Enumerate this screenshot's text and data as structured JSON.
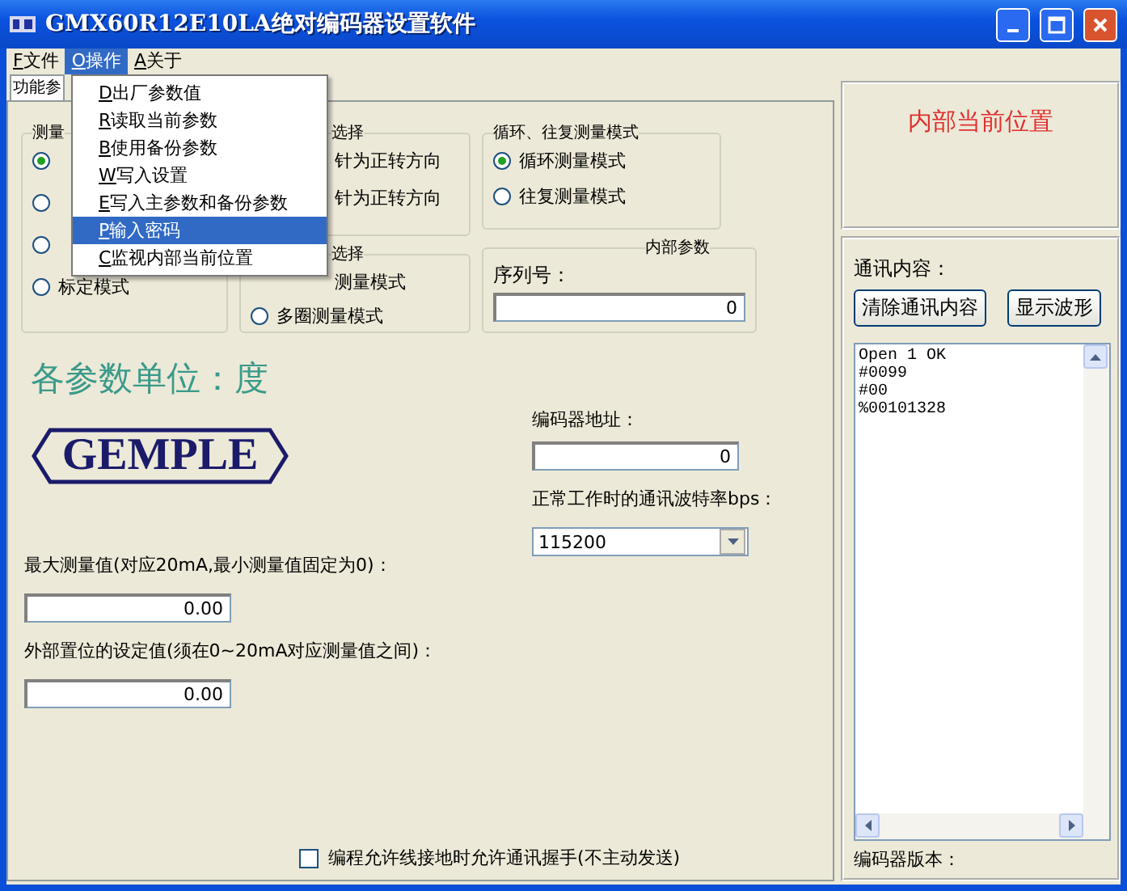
{
  "window": {
    "title": "GMX60R12E10LA绝对编码器设置软件"
  },
  "menu_bar": [
    {
      "mnemonic": "F",
      "label": "文件",
      "selected": false
    },
    {
      "mnemonic": "O",
      "label": "操作",
      "selected": true
    },
    {
      "mnemonic": "A",
      "label": "关于",
      "selected": false
    }
  ],
  "dropdown_menu": [
    {
      "mnemonic": "D",
      "label": "出厂参数值",
      "selected": false
    },
    {
      "mnemonic": "R",
      "label": "读取当前参数",
      "selected": false
    },
    {
      "mnemonic": "B",
      "label": "使用备份参数",
      "selected": false
    },
    {
      "mnemonic": "W",
      "label": "写入设置",
      "selected": false
    },
    {
      "mnemonic": "E",
      "label": "写入主参数和备份参数",
      "selected": false
    },
    {
      "mnemonic": "P",
      "label": "输入密码",
      "selected": true
    },
    {
      "mnemonic": "C",
      "label": "监视内部当前位置",
      "selected": false
    }
  ],
  "tab": {
    "label": "功能参"
  },
  "measure_group": {
    "title": "测量",
    "options": [
      {
        "selected": true
      },
      {
        "selected": false
      },
      {
        "selected": false
      },
      {
        "label": "标定模式",
        "selected": false
      }
    ]
  },
  "direction_group": {
    "title": "选择",
    "options": [
      {
        "label": "针为正转方向"
      },
      {
        "label": "针为正转方向"
      }
    ]
  },
  "turns_group": {
    "title": "选择",
    "options": [
      {
        "label": "测量模式"
      },
      {
        "label": "多圈测量模式",
        "selected": false
      }
    ]
  },
  "cycle_group": {
    "title": "循环、往复测量模式",
    "options": [
      {
        "label": "循环测量模式",
        "selected": true
      },
      {
        "label": "往复测量模式",
        "selected": false
      }
    ]
  },
  "internal_params": {
    "title": "内部参数",
    "serial_label": "序列号：",
    "serial_value": "0"
  },
  "units_heading": "各参数单位：度",
  "logo": "GEMPLE",
  "encoder_address": {
    "label": "编码器地址：",
    "value": "0"
  },
  "baud_rate": {
    "label": "正常工作时的通讯波特率bps：",
    "value": "115200"
  },
  "max_value": {
    "label": "最大测量值(对应20mA,最小测量值固定为0)：",
    "value": "0.00"
  },
  "reset_value": {
    "label": "外部置位的设定值(须在0~20mA对应测量值之间)：",
    "value": "0.00"
  },
  "handshake_checkbox": {
    "label": "编程允许线接地时允许通讯握手(不主动发送)",
    "checked": false
  },
  "position_title": "内部当前位置",
  "comm_label": "通讯内容：",
  "comm_buttons": [
    "清除通讯内容",
    "显示波形"
  ],
  "comm_log": [
    "Open 1 OK",
    "#0099",
    "#00",
    "%00101328"
  ],
  "version_label": "编码器版本："
}
